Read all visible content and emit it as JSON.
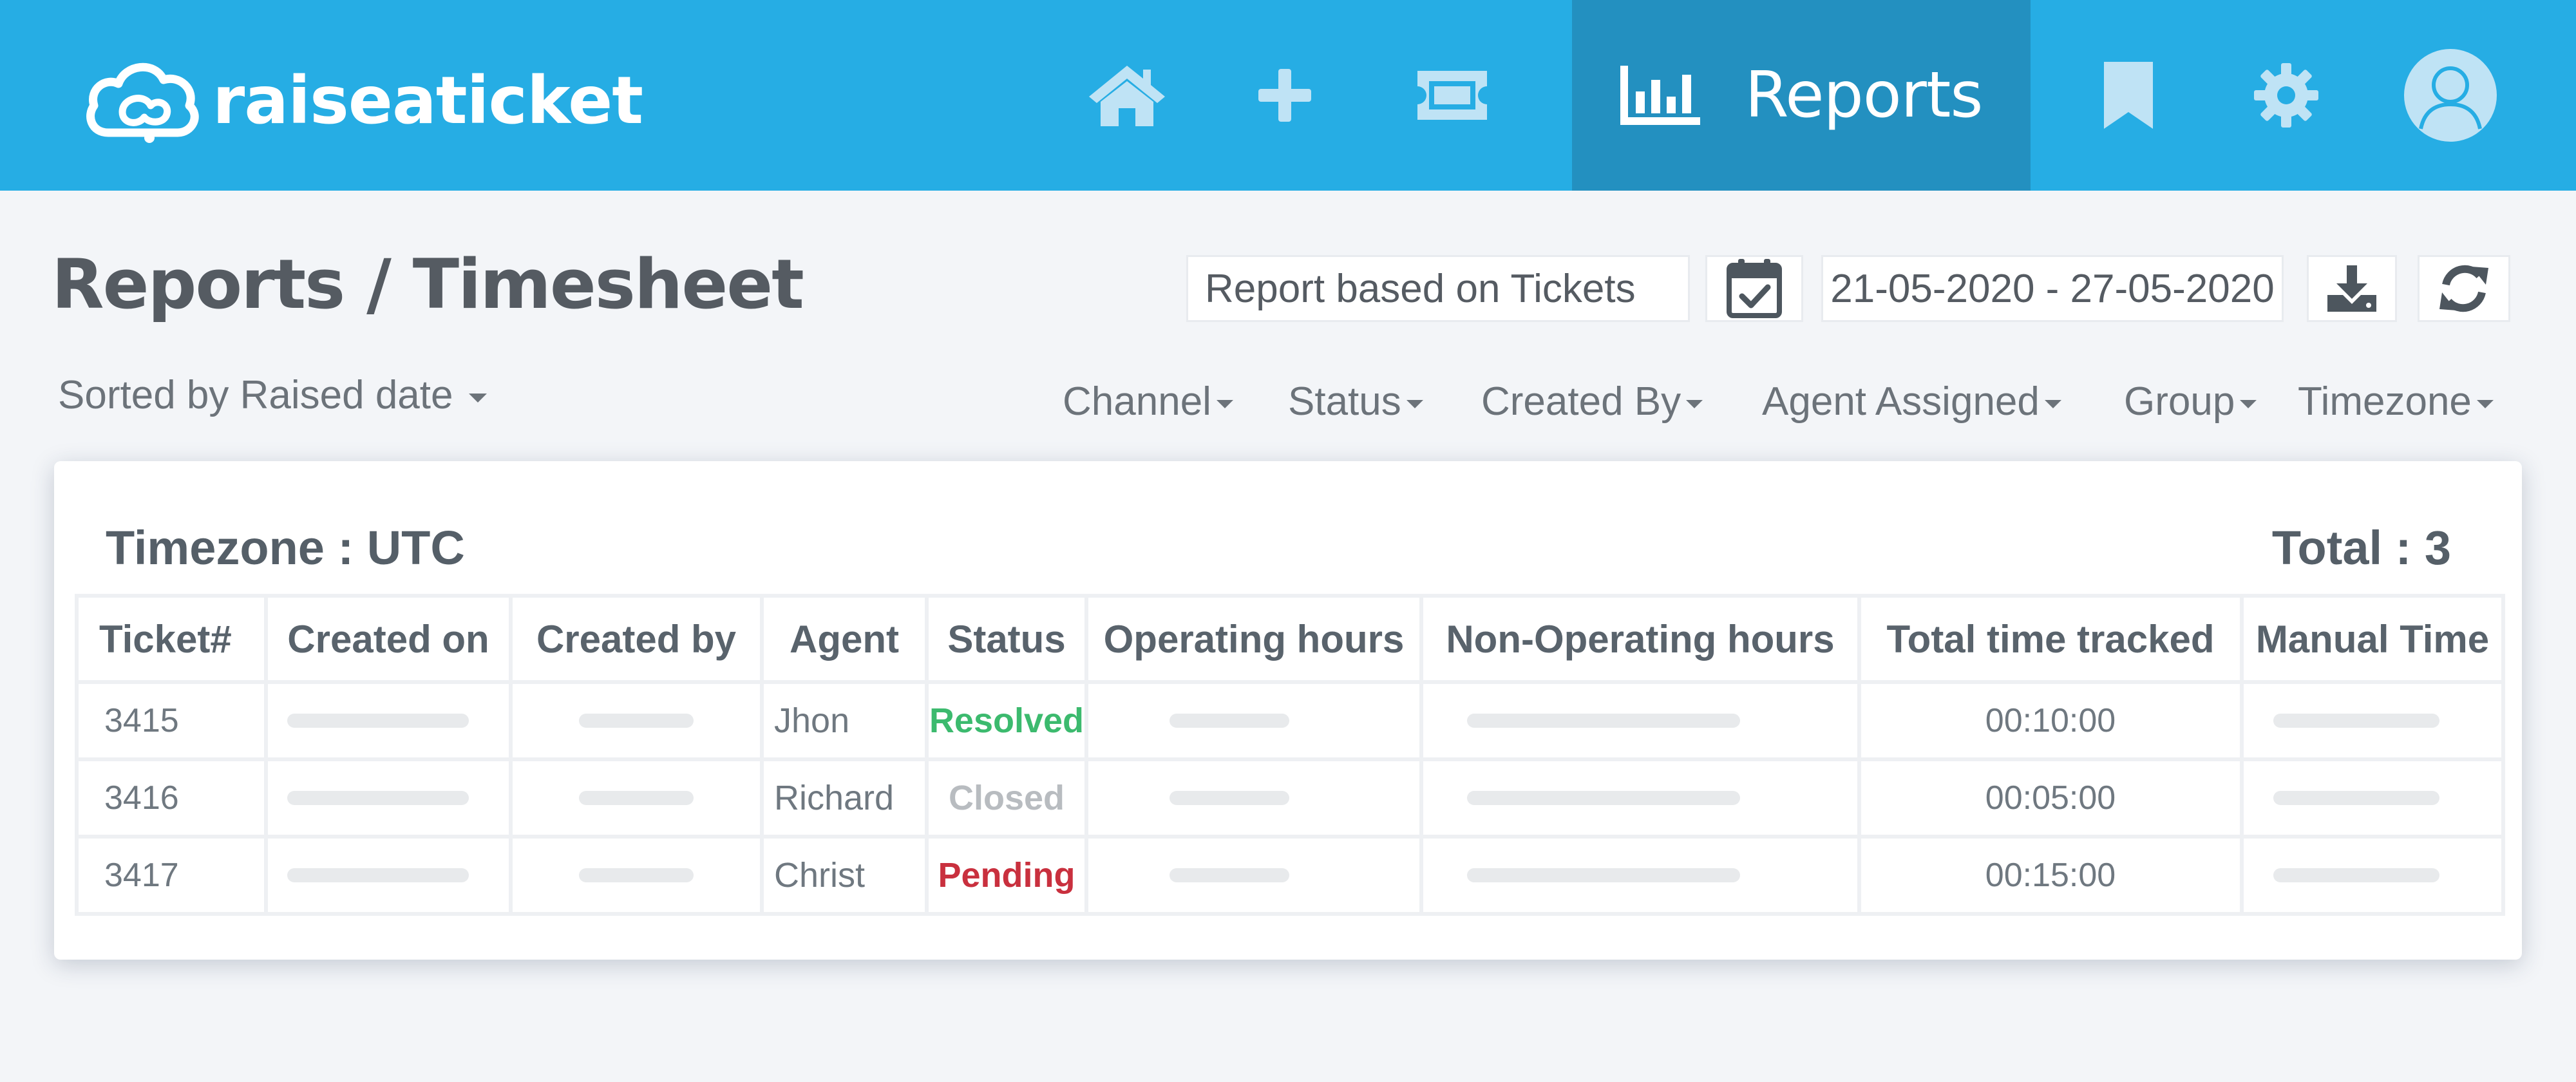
{
  "app": {
    "name": "raiseaticket"
  },
  "nav": {
    "items": [
      {
        "id": "home",
        "icon": "home-icon"
      },
      {
        "id": "add",
        "icon": "plus-icon"
      },
      {
        "id": "tickets",
        "icon": "ticket-icon"
      },
      {
        "id": "reports",
        "icon": "bar-chart-icon",
        "label": "Reports",
        "active": true
      },
      {
        "id": "bookmarks",
        "icon": "bookmark-icon"
      },
      {
        "id": "settings",
        "icon": "gear-icon"
      },
      {
        "id": "profile",
        "icon": "avatar-icon"
      }
    ]
  },
  "page": {
    "title": "Reports / Timesheet",
    "report_type": "Report based on Tickets",
    "date_range": "21-05-2020 - 27-05-2020",
    "sorted_by": "Sorted by Raised date"
  },
  "filters": [
    "Channel",
    "Status",
    "Created By",
    "Agent Assigned",
    "Group",
    "Timezone"
  ],
  "card": {
    "timezone_label": "Timezone : UTC",
    "total_label": "Total : 3"
  },
  "table": {
    "columns": [
      "Ticket#",
      "Created on",
      "Created by",
      "Agent",
      "Status",
      "Operating hours",
      "Non-Operating hours",
      "Total time tracked",
      "Manual Time"
    ],
    "rows": [
      {
        "ticket": "3415",
        "agent": "Jhon",
        "status": "Resolved",
        "total_time": "00:10:00"
      },
      {
        "ticket": "3416",
        "agent": "Richard",
        "status": "Closed",
        "total_time": "00:05:00"
      },
      {
        "ticket": "3417",
        "agent": "Christ",
        "status": "Pending",
        "total_time": "00:15:00"
      }
    ]
  },
  "colors": {
    "topbar": "#26ade4",
    "active_tab": "#2390c0",
    "resolved": "#3cba6e",
    "closed": "#b8bcc0",
    "pending": "#c9303e"
  }
}
